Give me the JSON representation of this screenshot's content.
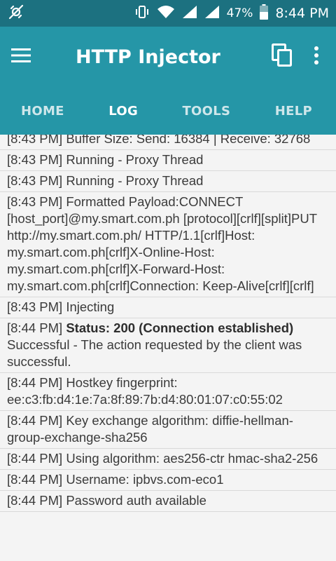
{
  "status_bar": {
    "battery_percent": "47%",
    "time": "8:44 PM"
  },
  "app_bar": {
    "title": "HTTP Injector"
  },
  "tabs": [
    {
      "label": "HOME",
      "active": false
    },
    {
      "label": "LOG",
      "active": true
    },
    {
      "label": "TOOLS",
      "active": false
    },
    {
      "label": "HELP",
      "active": false
    }
  ],
  "log": [
    {
      "time": "[8:43 PM]",
      "text": "Buffer Size: Send: 16384 | Receive: 32768"
    },
    {
      "time": "[8:43 PM]",
      "text": "Running - Proxy Thread"
    },
    {
      "time": "[8:43 PM]",
      "text": "Running - Proxy Thread"
    },
    {
      "time": "[8:43 PM]",
      "text": "Formatted Payload:CONNECT [host_port]@my.smart.com.ph [protocol][crlf][split]PUT http://my.smart.com.ph/ HTTP/1.1[crlf]Host: my.smart.com.ph[crlf]X-Online-Host: my.smart.com.ph[crlf]X-Forward-Host: my.smart.com.ph[crlf]Connection: Keep-Alive[crlf][crlf]"
    },
    {
      "time": "[8:43 PM]",
      "text": "Injecting"
    },
    {
      "time": "[8:44 PM]",
      "bold": "Status: 200 (Connection established)",
      "text": "Successful - The action requested by the client was successful."
    },
    {
      "time": "[8:44 PM]",
      "text": "Hostkey fingerprint: ee:c3:fb:d4:1e:7a:8f:89:7b:d4:80:01:07:c0:55:02"
    },
    {
      "time": "[8:44 PM]",
      "text": "Key exchange algorithm: diffie-hellman-group-exchange-sha256"
    },
    {
      "time": "[8:44 PM]",
      "text": "Using algorithm: aes256-ctr hmac-sha2-256"
    },
    {
      "time": "[8:44 PM]",
      "text": "Username: ipbvs.com-eco1"
    },
    {
      "time": "[8:44 PM]",
      "text": "Password auth available"
    }
  ]
}
